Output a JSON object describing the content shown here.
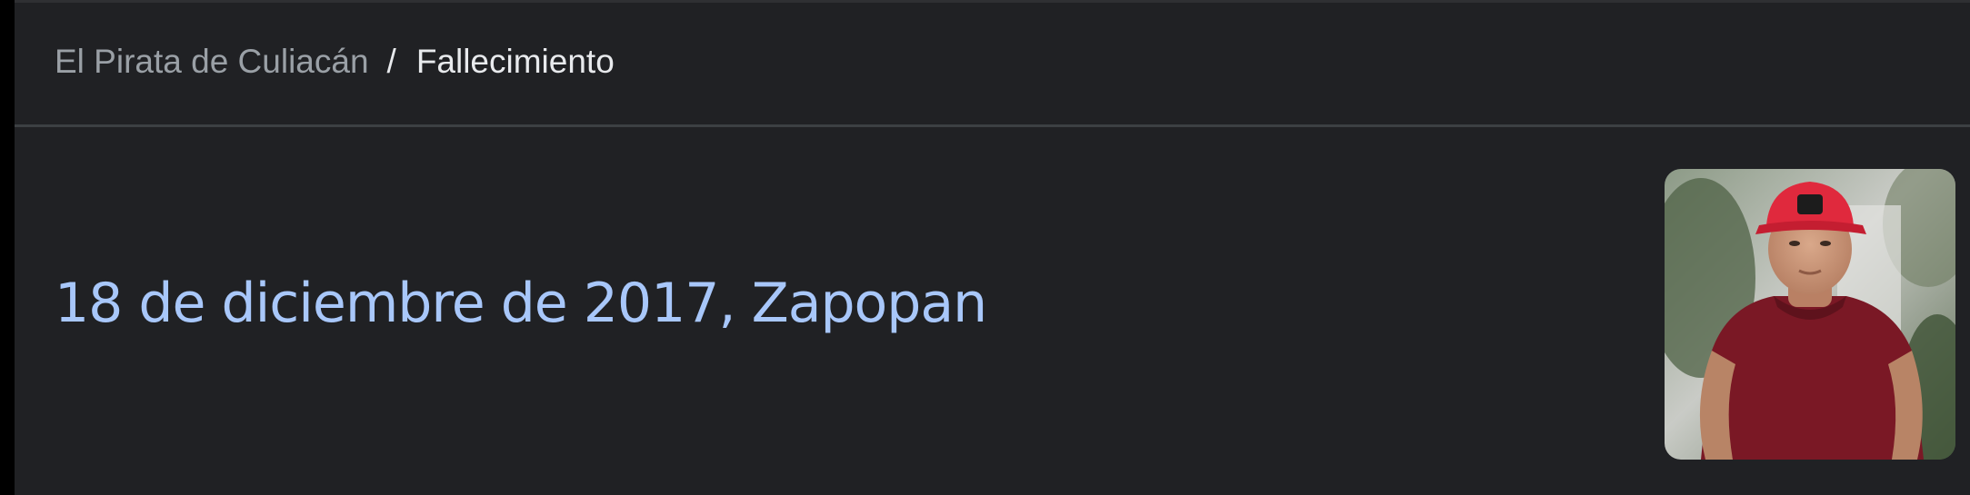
{
  "breadcrumb": {
    "parent": "El Pirata de Culiacán",
    "separator": "/",
    "current": "Fallecimiento"
  },
  "main": {
    "value": "18 de diciembre de 2017, Zapopan"
  },
  "colors": {
    "background": "#202124",
    "divider": "#3c4043",
    "breadcrumb_parent": "#9aa0a6",
    "breadcrumb_current": "#e8eaed",
    "headline": "#a8c7fa"
  },
  "image": {
    "subject_icon": "person-photo"
  }
}
